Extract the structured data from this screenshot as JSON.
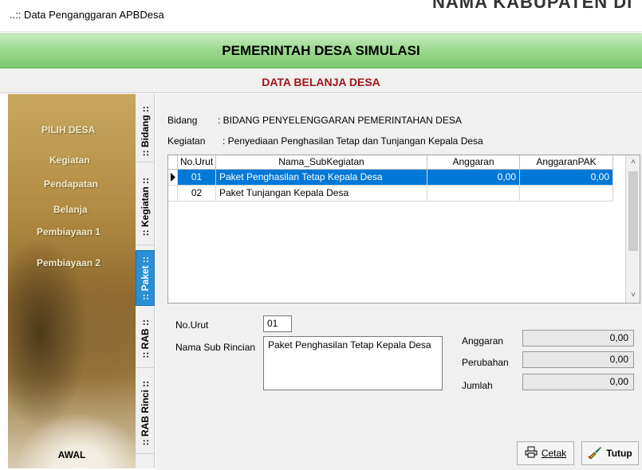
{
  "window": {
    "title": "..:: Data Penganggaran APBDesa",
    "ghost_text": "NAMA KABUPATEN DI"
  },
  "header": {
    "title": "PEMERINTAH DESA SIMULASI",
    "subtitle": "DATA BELANJA DESA"
  },
  "sidebar": {
    "items": [
      {
        "label": "PILIH DESA"
      },
      {
        "label": "Kegiatan"
      },
      {
        "label": "Pendapatan"
      },
      {
        "label": "Belanja"
      },
      {
        "label": "Pembiayaan 1"
      },
      {
        "label": "Pembiayaan 2"
      }
    ],
    "bottom_label": "AWAL"
  },
  "tabs": [
    {
      "label": ":: Bidang ::"
    },
    {
      "label": ":: Kegiatan ::"
    },
    {
      "label": ":: Paket ::",
      "active": true
    },
    {
      "label": ":: RAB ::"
    },
    {
      "label": ":: RAB Rinci ::"
    }
  ],
  "info": {
    "bidang_label": "Bidang",
    "bidang_value": ": BIDANG PENYELENGGARAN PEMERINTAHAN DESA",
    "kegiatan_label": "Kegiatan",
    "kegiatan_value": ": Penyediaan Penghasilan Tetap dan Tunjangan Kepala Desa"
  },
  "table": {
    "columns": [
      "No.Urut",
      "Nama_SubKegiatan",
      "Anggaran",
      "AnggaranPAK"
    ],
    "rows": [
      {
        "no": "01",
        "nama": "Paket Penghasilan Tetap Kepala Desa",
        "anggaran": "0,00",
        "pak": "0,00",
        "selected": true
      },
      {
        "no": "02",
        "nama": "Paket Tunjangan Kepala Desa",
        "anggaran": "",
        "pak": ""
      }
    ]
  },
  "form": {
    "no_urut_label": "No.Urut",
    "no_urut_value": "01",
    "nama_label": "Nama Sub Rincian",
    "nama_value": "Paket Penghasilan Tetap Kepala Desa",
    "anggaran_label": "Anggaran",
    "anggaran_value": "0,00",
    "perubahan_label": "Perubahan",
    "perubahan_value": "0,00",
    "jumlah_label": "Jumlah",
    "jumlah_value": "0,00"
  },
  "buttons": {
    "cetak": "Cetak",
    "tutup": "Tutup"
  },
  "icons": {
    "printer": "printer-icon",
    "brush": "brush-icon",
    "scroll_up": "chevron-up-icon",
    "scroll_down": "chevron-down-icon",
    "row_pointer": "row-pointer-icon"
  },
  "colors": {
    "banner_green": "#9edb92",
    "subtitle_red": "#a0161a",
    "active_tab": "#2a8fd6",
    "selection": "#0078d7"
  }
}
